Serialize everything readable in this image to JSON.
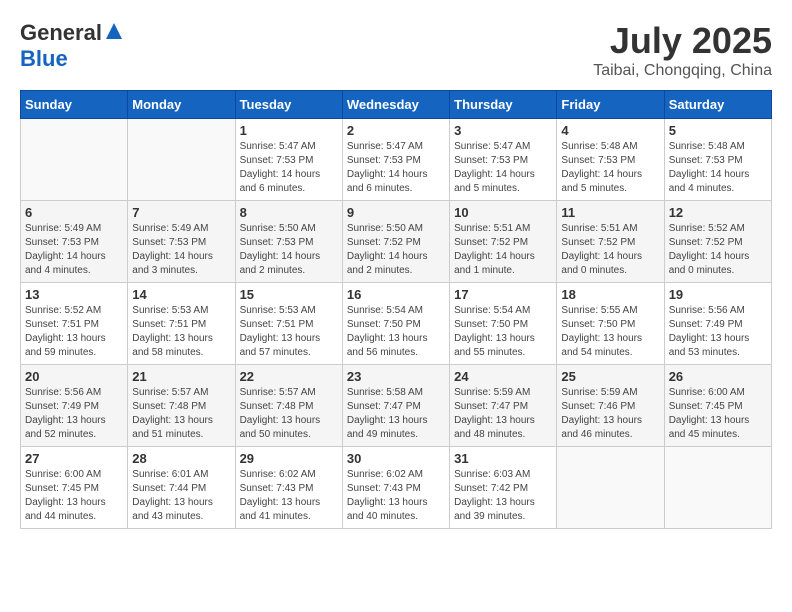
{
  "logo": {
    "general": "General",
    "blue": "Blue"
  },
  "title": {
    "month_year": "July 2025",
    "location": "Taibai, Chongqing, China"
  },
  "calendar": {
    "headers": [
      "Sunday",
      "Monday",
      "Tuesday",
      "Wednesday",
      "Thursday",
      "Friday",
      "Saturday"
    ],
    "weeks": [
      [
        {
          "day": "",
          "info": ""
        },
        {
          "day": "",
          "info": ""
        },
        {
          "day": "1",
          "info": "Sunrise: 5:47 AM\nSunset: 7:53 PM\nDaylight: 14 hours\nand 6 minutes."
        },
        {
          "day": "2",
          "info": "Sunrise: 5:47 AM\nSunset: 7:53 PM\nDaylight: 14 hours\nand 6 minutes."
        },
        {
          "day": "3",
          "info": "Sunrise: 5:47 AM\nSunset: 7:53 PM\nDaylight: 14 hours\nand 5 minutes."
        },
        {
          "day": "4",
          "info": "Sunrise: 5:48 AM\nSunset: 7:53 PM\nDaylight: 14 hours\nand 5 minutes."
        },
        {
          "day": "5",
          "info": "Sunrise: 5:48 AM\nSunset: 7:53 PM\nDaylight: 14 hours\nand 4 minutes."
        }
      ],
      [
        {
          "day": "6",
          "info": "Sunrise: 5:49 AM\nSunset: 7:53 PM\nDaylight: 14 hours\nand 4 minutes."
        },
        {
          "day": "7",
          "info": "Sunrise: 5:49 AM\nSunset: 7:53 PM\nDaylight: 14 hours\nand 3 minutes."
        },
        {
          "day": "8",
          "info": "Sunrise: 5:50 AM\nSunset: 7:53 PM\nDaylight: 14 hours\nand 2 minutes."
        },
        {
          "day": "9",
          "info": "Sunrise: 5:50 AM\nSunset: 7:52 PM\nDaylight: 14 hours\nand 2 minutes."
        },
        {
          "day": "10",
          "info": "Sunrise: 5:51 AM\nSunset: 7:52 PM\nDaylight: 14 hours\nand 1 minute."
        },
        {
          "day": "11",
          "info": "Sunrise: 5:51 AM\nSunset: 7:52 PM\nDaylight: 14 hours\nand 0 minutes."
        },
        {
          "day": "12",
          "info": "Sunrise: 5:52 AM\nSunset: 7:52 PM\nDaylight: 14 hours\nand 0 minutes."
        }
      ],
      [
        {
          "day": "13",
          "info": "Sunrise: 5:52 AM\nSunset: 7:51 PM\nDaylight: 13 hours\nand 59 minutes."
        },
        {
          "day": "14",
          "info": "Sunrise: 5:53 AM\nSunset: 7:51 PM\nDaylight: 13 hours\nand 58 minutes."
        },
        {
          "day": "15",
          "info": "Sunrise: 5:53 AM\nSunset: 7:51 PM\nDaylight: 13 hours\nand 57 minutes."
        },
        {
          "day": "16",
          "info": "Sunrise: 5:54 AM\nSunset: 7:50 PM\nDaylight: 13 hours\nand 56 minutes."
        },
        {
          "day": "17",
          "info": "Sunrise: 5:54 AM\nSunset: 7:50 PM\nDaylight: 13 hours\nand 55 minutes."
        },
        {
          "day": "18",
          "info": "Sunrise: 5:55 AM\nSunset: 7:50 PM\nDaylight: 13 hours\nand 54 minutes."
        },
        {
          "day": "19",
          "info": "Sunrise: 5:56 AM\nSunset: 7:49 PM\nDaylight: 13 hours\nand 53 minutes."
        }
      ],
      [
        {
          "day": "20",
          "info": "Sunrise: 5:56 AM\nSunset: 7:49 PM\nDaylight: 13 hours\nand 52 minutes."
        },
        {
          "day": "21",
          "info": "Sunrise: 5:57 AM\nSunset: 7:48 PM\nDaylight: 13 hours\nand 51 minutes."
        },
        {
          "day": "22",
          "info": "Sunrise: 5:57 AM\nSunset: 7:48 PM\nDaylight: 13 hours\nand 50 minutes."
        },
        {
          "day": "23",
          "info": "Sunrise: 5:58 AM\nSunset: 7:47 PM\nDaylight: 13 hours\nand 49 minutes."
        },
        {
          "day": "24",
          "info": "Sunrise: 5:59 AM\nSunset: 7:47 PM\nDaylight: 13 hours\nand 48 minutes."
        },
        {
          "day": "25",
          "info": "Sunrise: 5:59 AM\nSunset: 7:46 PM\nDaylight: 13 hours\nand 46 minutes."
        },
        {
          "day": "26",
          "info": "Sunrise: 6:00 AM\nSunset: 7:45 PM\nDaylight: 13 hours\nand 45 minutes."
        }
      ],
      [
        {
          "day": "27",
          "info": "Sunrise: 6:00 AM\nSunset: 7:45 PM\nDaylight: 13 hours\nand 44 minutes."
        },
        {
          "day": "28",
          "info": "Sunrise: 6:01 AM\nSunset: 7:44 PM\nDaylight: 13 hours\nand 43 minutes."
        },
        {
          "day": "29",
          "info": "Sunrise: 6:02 AM\nSunset: 7:43 PM\nDaylight: 13 hours\nand 41 minutes."
        },
        {
          "day": "30",
          "info": "Sunrise: 6:02 AM\nSunset: 7:43 PM\nDaylight: 13 hours\nand 40 minutes."
        },
        {
          "day": "31",
          "info": "Sunrise: 6:03 AM\nSunset: 7:42 PM\nDaylight: 13 hours\nand 39 minutes."
        },
        {
          "day": "",
          "info": ""
        },
        {
          "day": "",
          "info": ""
        }
      ]
    ]
  }
}
